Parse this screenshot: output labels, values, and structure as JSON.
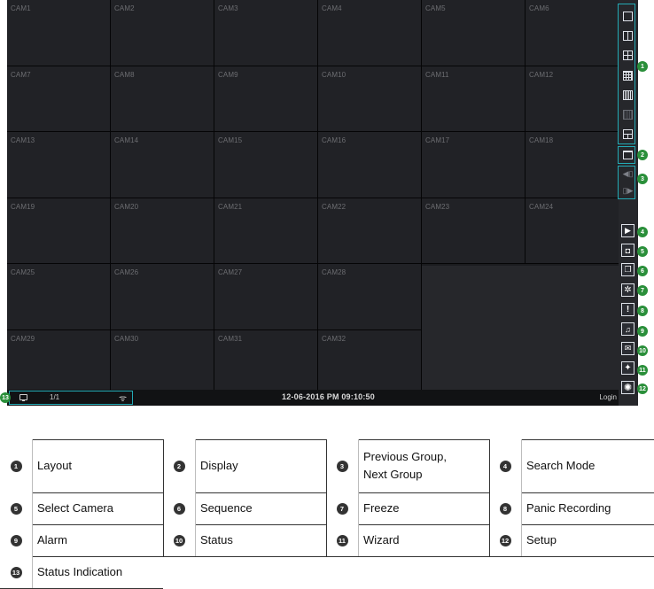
{
  "cameras": [
    "CAM1",
    "CAM2",
    "CAM3",
    "CAM4",
    "CAM5",
    "CAM6",
    "CAM7",
    "CAM8",
    "CAM9",
    "CAM10",
    "CAM11",
    "CAM12",
    "CAM13",
    "CAM14",
    "CAM15",
    "CAM16",
    "CAM17",
    "CAM18",
    "CAM19",
    "CAM20",
    "CAM21",
    "CAM22",
    "CAM23",
    "CAM24",
    "CAM25",
    "CAM26",
    "CAM27",
    "CAM28",
    "CAM29",
    "CAM30",
    "CAM31",
    "CAM32"
  ],
  "status": {
    "page": "1/1",
    "datetime": "12-06-2016  PM 09:10:50",
    "login": "Login"
  },
  "callouts": [
    "1",
    "2",
    "3",
    "4",
    "5",
    "6",
    "7",
    "8",
    "9",
    "10",
    "11",
    "12",
    "13"
  ],
  "toolbar_icons": [
    "layout-1-icon",
    "layout-2-icon",
    "layout-4-icon",
    "layout-9-icon",
    "layout-16-icon",
    "layout-25-icon",
    "layout-custom-icon",
    "display-icon",
    "previous-group-icon",
    "next-group-icon",
    "search-mode-icon",
    "select-camera-icon",
    "sequence-icon",
    "freeze-icon",
    "panic-recording-icon",
    "alarm-icon",
    "status-icon",
    "wizard-icon",
    "setup-icon"
  ],
  "legend": [
    {
      "num": "1",
      "label": "Layout"
    },
    {
      "num": "2",
      "label": "Display"
    },
    {
      "num": "3",
      "label": "Previous Group,\nNext Group"
    },
    {
      "num": "4",
      "label": "Search Mode"
    },
    {
      "num": "5",
      "label": "Select Camera"
    },
    {
      "num": "6",
      "label": "Sequence"
    },
    {
      "num": "7",
      "label": "Freeze"
    },
    {
      "num": "8",
      "label": "Panic Recording"
    },
    {
      "num": "9",
      "label": "Alarm"
    },
    {
      "num": "10",
      "label": "Status"
    },
    {
      "num": "11",
      "label": "Wizard"
    },
    {
      "num": "12",
      "label": "Setup"
    },
    {
      "num": "13",
      "label": "Status Indication"
    }
  ],
  "colors": {
    "screen_bg": "#1b1c1f",
    "callout_green": "#2a8f3a",
    "highlight_teal": "#23aab5",
    "icon_stroke": "#dfe3ea"
  }
}
